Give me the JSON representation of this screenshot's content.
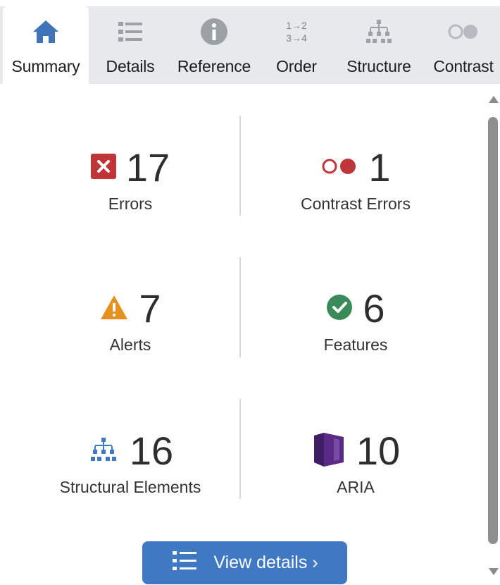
{
  "tabs": [
    {
      "label": "Summary",
      "icon": "home-icon",
      "active": true
    },
    {
      "label": "Details",
      "icon": "list-icon"
    },
    {
      "label": "Reference",
      "icon": "info-icon"
    },
    {
      "label": "Order",
      "icon": "order-icon",
      "icon_text": [
        "1→2",
        "3→4"
      ]
    },
    {
      "label": "Structure",
      "icon": "hierarchy-icon"
    },
    {
      "label": "Contrast",
      "icon": "contrast-icon"
    }
  ],
  "stats": {
    "errors": {
      "value": "17",
      "label": "Errors",
      "icon": "error-x-icon",
      "color": "#c0353a"
    },
    "contrast": {
      "value": "1",
      "label": "Contrast Errors",
      "icon": "contrast-error-icon",
      "color": "#c0353a"
    },
    "alerts": {
      "value": "7",
      "label": "Alerts",
      "icon": "warning-triangle-icon",
      "color": "#e6901e"
    },
    "features": {
      "value": "6",
      "label": "Features",
      "icon": "check-circle-icon",
      "color": "#3a8a5a"
    },
    "structural": {
      "value": "16",
      "label": "Structural Elements",
      "icon": "hierarchy-icon",
      "color": "#3f79c4"
    },
    "aria": {
      "value": "10",
      "label": "ARIA",
      "icon": "aria-cube-icon",
      "color": "#5a2b84"
    }
  },
  "view_details": {
    "label": "View details ›",
    "icon": "list-icon",
    "color": "#3f79c4"
  }
}
